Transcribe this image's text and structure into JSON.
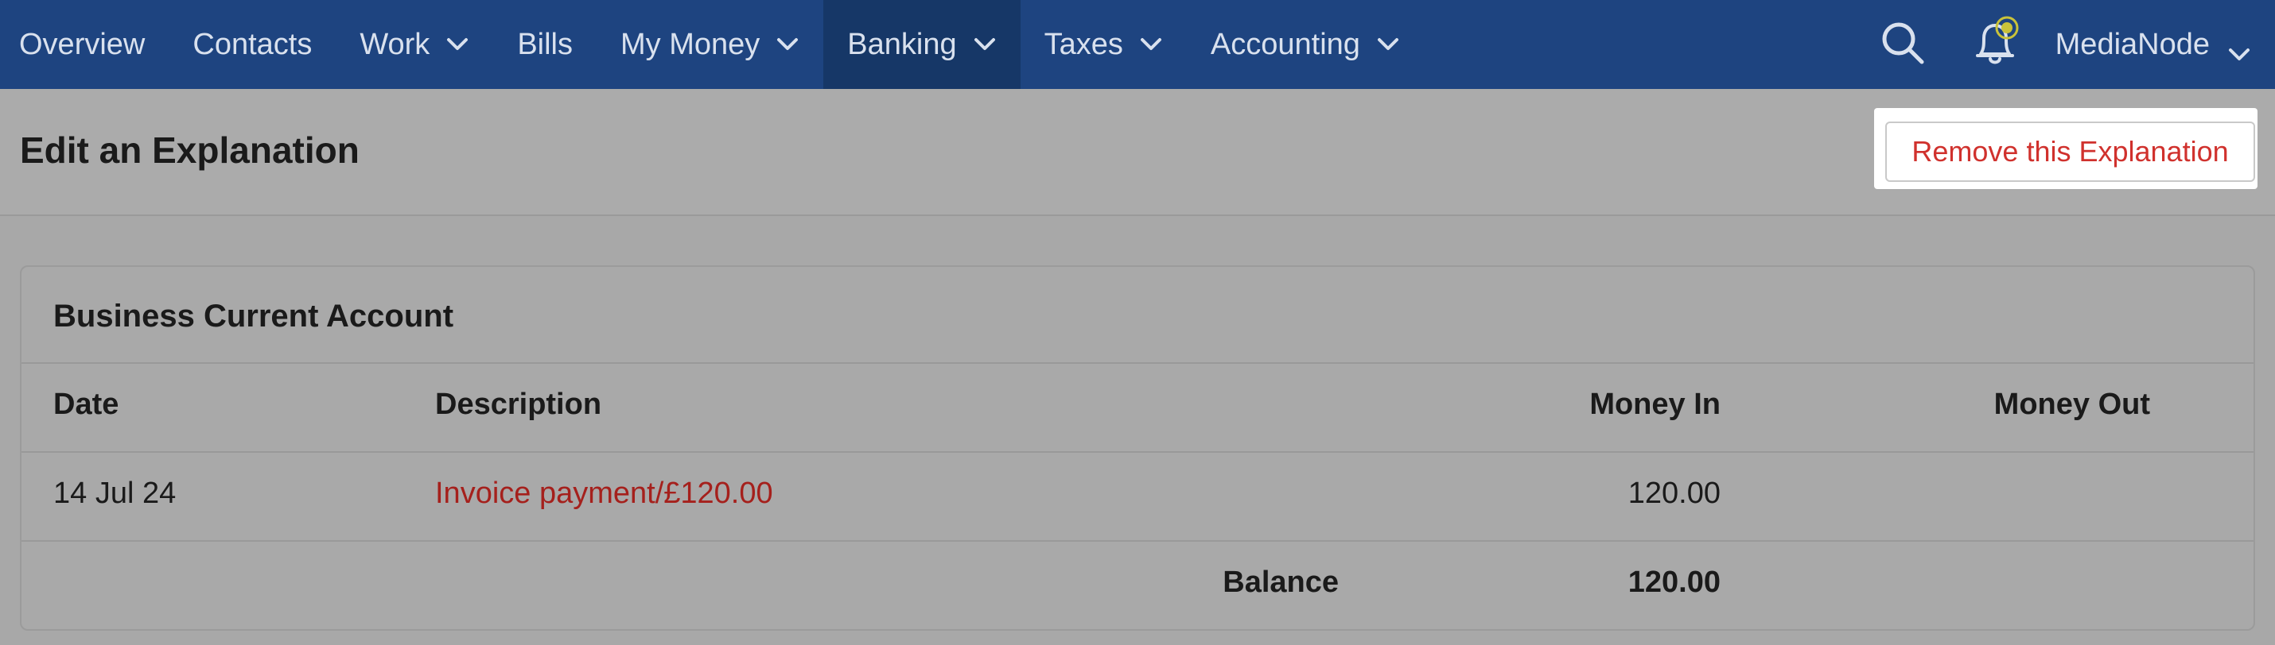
{
  "nav": {
    "items": [
      {
        "label": "Overview",
        "dropdown": false,
        "active": false
      },
      {
        "label": "Contacts",
        "dropdown": false,
        "active": false
      },
      {
        "label": "Work",
        "dropdown": true,
        "active": false
      },
      {
        "label": "Bills",
        "dropdown": false,
        "active": false
      },
      {
        "label": "My Money",
        "dropdown": true,
        "active": false
      },
      {
        "label": "Banking",
        "dropdown": true,
        "active": true
      },
      {
        "label": "Taxes",
        "dropdown": true,
        "active": false
      },
      {
        "label": "Accounting",
        "dropdown": true,
        "active": false
      }
    ],
    "search_icon": "search-icon",
    "notification_icon": "bell-icon",
    "account_name": "MediaNode"
  },
  "header": {
    "title": "Edit an Explanation",
    "remove_label": "Remove this Explanation"
  },
  "account": {
    "title": "Business Current Account",
    "columns": {
      "date": "Date",
      "description": "Description",
      "money_in": "Money In",
      "money_out": "Money Out"
    },
    "rows": [
      {
        "date": "14 Jul 24",
        "description": "Invoice payment/£120.00",
        "money_in": "120.00",
        "money_out": ""
      }
    ],
    "balance_label": "Balance",
    "balance_value": "120.00"
  },
  "colors": {
    "nav_bg": "#1e4480",
    "nav_active_bg": "#163767",
    "danger": "#d0312d",
    "link": "#a5201c",
    "notification_badge": "#c9c23a"
  }
}
